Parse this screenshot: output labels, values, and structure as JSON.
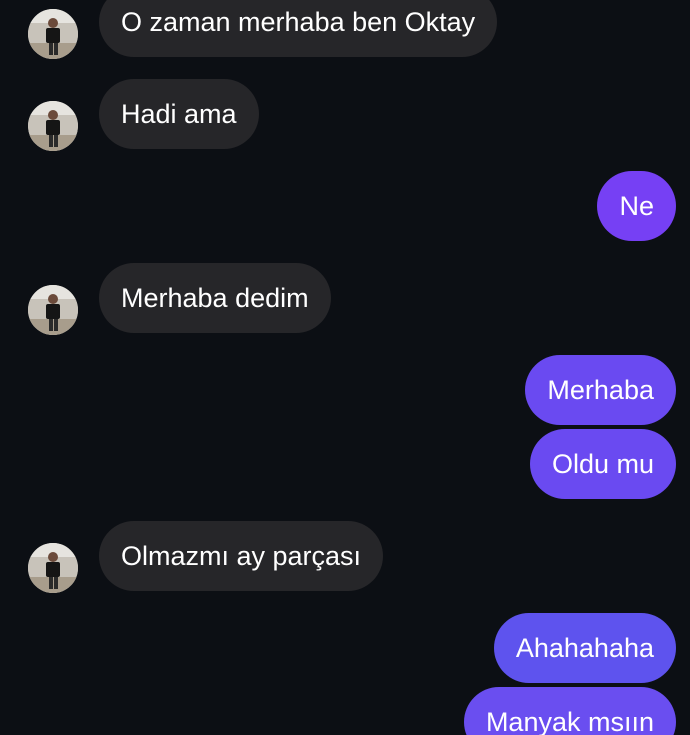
{
  "messages": [
    {
      "side": "incoming",
      "text": "O zaman merhaba ben Oktay",
      "avatar": "contact-avatar"
    },
    {
      "side": "incoming",
      "text": "Hadi ama",
      "avatar": "contact-avatar"
    },
    {
      "side": "outgoing",
      "text": "Ne"
    },
    {
      "side": "incoming",
      "text": "Merhaba dedim",
      "avatar": "contact-avatar"
    },
    {
      "side": "outgoing",
      "text": "Merhaba"
    },
    {
      "side": "outgoing",
      "text": "Oldu mu"
    },
    {
      "side": "incoming",
      "text": "Olmazmı ay parçası",
      "avatar": "contact-avatar"
    },
    {
      "side": "outgoing",
      "text": "Ahahahaha"
    },
    {
      "side": "outgoing",
      "text": "Manyak msıın"
    }
  ],
  "colors": {
    "background": "#0c0f14",
    "incoming_bubble": "#262629",
    "outgoing_bubble": "#7640f4",
    "text": "#ffffff"
  }
}
